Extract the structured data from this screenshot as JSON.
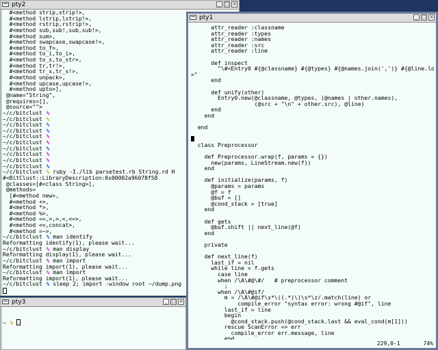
{
  "colors": {
    "desktop": "#1e3560",
    "terminal_bg": "#f3fcf8",
    "titlebar_bg": "#dcdcdc",
    "prompt_percent_cycle": [
      "#c000c0",
      "#c0a000",
      "#0040e0",
      "#c000c0",
      "#c0a000",
      "#0040e0",
      "#c000c0",
      "#c0a000",
      "#0040e0",
      "#c000c0"
    ]
  },
  "icons": {
    "window_menu": "window-menu-icon",
    "minimize": "minimize-icon",
    "maximize": "maximize-icon",
    "close": "close-icon"
  },
  "pty2": {
    "title": "pty2",
    "buttons": [
      "_",
      "□",
      "×"
    ],
    "lines": [
      "  #<method strip,strip!>,",
      "  #<method lstrip,lstrip!>,",
      "  #<method rstrip,rstrip!>,",
      "  #<method sub,sub!,sub,sub!>,",
      "  #<method sum>,",
      "  #<method swapcase,swapcase!>,",
      "  #<method to_f>,",
      "  #<method to_i,to_i>,",
      "  #<method to_s,to_str>,",
      "  #<method tr,tr!>,",
      "  #<method tr_s,tr_s!>,",
      "  #<method unpack>,",
      "  #<method upcase,upcase!>,",
      "  #<method upto>],",
      " @name=\"String\",",
      " @requires=[],",
      " @source=\"\">",
      {
        "path": "~/c/bitclust ",
        "pct": "%",
        "color": "#c000c0",
        "cmd": ""
      },
      {
        "path": "~/c/bitclust ",
        "pct": "%",
        "color": "#c0a000",
        "cmd": ""
      },
      {
        "path": "~/c/bitclust ",
        "pct": "%",
        "color": "#0040e0",
        "cmd": ""
      },
      {
        "path": "~/c/bitclust ",
        "pct": "%",
        "color": "#0040e0",
        "cmd": ""
      },
      {
        "path": "~/c/bitclust ",
        "pct": "%",
        "color": "#c000c0",
        "cmd": ""
      },
      {
        "path": "~/c/bitclust ",
        "pct": "%",
        "color": "#c000c0",
        "cmd": ""
      },
      {
        "path": "~/c/bitclust ",
        "pct": "%",
        "color": "#0040e0",
        "cmd": ""
      },
      {
        "path": "~/c/bitclust ",
        "pct": "%",
        "color": "#c000c0",
        "cmd": ""
      },
      {
        "path": "~/c/bitclust ",
        "pct": "%",
        "color": "#c000c0",
        "cmd": ""
      },
      {
        "path": "~/c/bitclust ",
        "pct": "%",
        "color": "#0040e0",
        "cmd": ""
      },
      {
        "path": "~/c/bitclust ",
        "pct": "%",
        "color": "#c0a000",
        "cmd": " ruby -I./lib parsetest.rb String.rd H"
      },
      "#<BitClust::LibraryDescription:0x00002a96078f58",
      " @classes=[#<class String>],",
      " @methods=",
      "  [#<method new>,",
      "  #<method +>,",
      "  #<method *>,",
      "  #<method %>,",
      "  #<method ==,>,>,<,<=>,",
      "  #<method <<,concat>,",
      "  #<method =~>,",
      {
        "path": "~/c/bitclust ",
        "pct": "%",
        "color": "#0040e0",
        "cmd": " man identify"
      },
      "Reformatting identify(1), please wait...",
      {
        "path": "~/c/bitclust ",
        "pct": "%",
        "color": "#c000c0",
        "cmd": " man display"
      },
      "Reformatting display(1), please wait...",
      {
        "path": "~/c/bitclust ",
        "pct": "%",
        "color": "#c000c0",
        "cmd": " man import"
      },
      "Reformatting import(1), please wait...",
      {
        "path": "~/c/bitclust ",
        "pct": "%",
        "color": "#c000c0",
        "cmd": " man import"
      },
      "Reformatting import(1), please wait...",
      {
        "path": "~/c/bitclust ",
        "pct": "%",
        "color": "#0040e0",
        "cmd": " sleep 2; import -window root ~/dump.png"
      }
    ]
  },
  "pty3": {
    "title": "pty3",
    "buttons": [
      "_",
      "□",
      "×"
    ],
    "prompt_path": "~ ",
    "prompt_pct": "%",
    "prompt_color": "#c0a000"
  },
  "pty1": {
    "title": "pty1",
    "buttons": [
      "_",
      "□",
      "×"
    ],
    "lines": [
      "      attr_reader :classname",
      "      attr_reader :types",
      "      attr_reader :names",
      "      attr_reader :src",
      "      attr_reader :line",
      "",
      "      def inspect",
      "        \"\\#<Entry0 #{@classname} #{@types} #{@names.join(',')} #{@line.location}",
      ">\"",
      "      end",
      "",
      "      def unify(other)",
      "        Entry0.new(@classname, @types, (@names | other.names),",
      "                   (@src + \"\\n\" + other.src), @line)",
      "      end",
      "    end",
      "",
      "  end",
      "",
      "CURSOR",
      "  class Preprocessor",
      "",
      "    def Preprocessor.wrap(f, params = {})",
      "      new(params, LineStream.new(f))",
      "    end",
      "",
      "    def initialize(params, f)",
      "      @params = params",
      "      @f = f",
      "      @buf = []",
      "      @cond_stack = [true]",
      "    end",
      "",
      "    def gets",
      "      @buf.shift || next_line(@f)",
      "    end",
      "",
      "    private",
      "",
      "    def next_line(f)",
      "      last_if = nil",
      "      while line = f.gets",
      "        case line",
      "        when /\\A\\#@\\#/   # preprocessor comment",
      "          ;",
      "        when /\\A\\#@if/",
      "          m = /\\A\\#@if\\s*\\((.*)\\)\\s*\\z/.match(line) or",
      "              compile_error \"syntax error: wrong #@if\", line",
      "          last_if = line",
      "          begin",
      "            @cond_stack.push(@cond_stack.last && eval_cond(m[1]))",
      "          rescue ScanError => err",
      "            compile_error err.message, line",
      "          end",
      "        when /\\A\\#@else/"
    ],
    "status_position": "229,0-1",
    "status_percent": "74%"
  }
}
